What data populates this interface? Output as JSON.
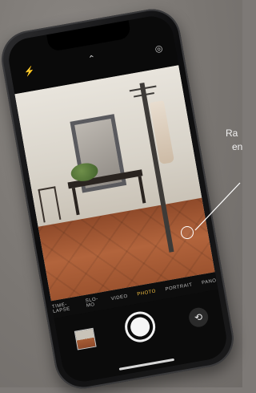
{
  "camera": {
    "modes": [
      "Time-lapse",
      "Slo-mo",
      "Video",
      "Photo",
      "Portrait",
      "Pano"
    ],
    "active_mode": "Photo"
  },
  "icons": {
    "flash": "flash-icon",
    "chevron": "chevron-up-icon",
    "live": "live-photo-icon",
    "flip": "flip-camera-icon",
    "thumbnail": "photo-thumbnail"
  },
  "colors": {
    "background": "#7d7976",
    "active_mode": "#f6c142",
    "focus_ring": "#ffffff"
  },
  "annotation": {
    "callout_text": "Ra\nen"
  }
}
